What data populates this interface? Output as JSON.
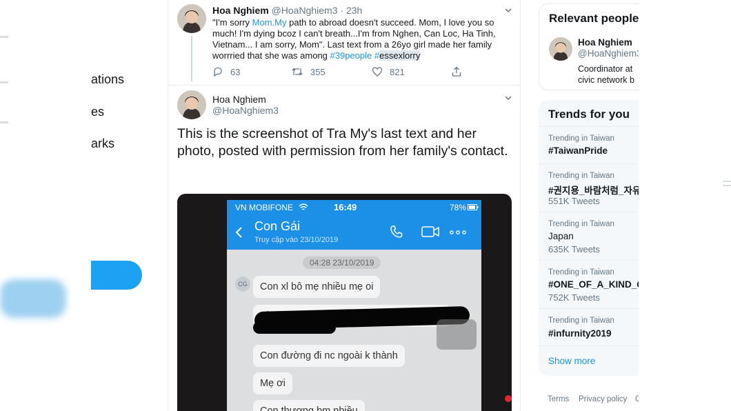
{
  "nav": {
    "items": [
      "ations",
      "es",
      "arks"
    ]
  },
  "tweet1": {
    "name": "Hoa Nghiem",
    "handle": "@HoaNghiem3",
    "time": "· 23h",
    "text_1": "\"I'm sorry ",
    "link_mom": "Mom.My",
    "text_2": " path to abroad doesn't succeed. Mom, I love you so much! I'm dying bcoz I can't breath...I'm from Nghen, Can Loc, Ha Tinh, Vietnam... I am sorry, Mom\". Last text from a 26yo girl made her family worrried that she was among ",
    "hashtag_1": "#39people",
    "hashtag_2_hash": "#",
    "hashtag_2_word": "essexlorry",
    "replies": "63",
    "retweets": "355",
    "likes": "821"
  },
  "tweet2": {
    "name": "Hoa Nghiem",
    "handle": "@HoaNghiem3",
    "text": "This is the screenshot of Tra My's last text and her photo, posted with permission from her family's contact."
  },
  "phone": {
    "carrier": "VN MOBIFONE",
    "time": "16:49",
    "battery": "78%",
    "chat_name": "Con Gái",
    "chat_subtitle": "Truy cập vào 23/10/2019",
    "date_chip": "04:28 23/10/2019",
    "avatar_initials": "CG",
    "messages": [
      "Con xl bô mẹ nhiều mẹ oi",
      "Ph",
      "Con đường đi nc ngoài k thành",
      "Mẹ ơi",
      "Con thương bm nhiều"
    ]
  },
  "sidebar": {
    "relevant_title": "Relevant people",
    "relevant_name": "Hoa Nghiem",
    "relevant_handle": "@HoaNghiem3",
    "relevant_bio": "Coordinator at civic network b",
    "trends_title": "Trends for you",
    "trends": [
      {
        "context": "Trending in Taiwan",
        "name": "#TaiwanPride",
        "count": ""
      },
      {
        "context": "Trending in Taiwan",
        "name": "#권지용_바람처럼_자유",
        "count": "551K Tweets"
      },
      {
        "context": "Trending in Taiwan",
        "name": "Japan",
        "count": "635K Tweets"
      },
      {
        "context": "Trending in Taiwan",
        "name": "#ONE_OF_A_KIND_G",
        "count": "752K Tweets"
      },
      {
        "context": "Trending in Taiwan",
        "name": "#infurnity2019",
        "count": ""
      }
    ],
    "show_more": "Show more",
    "footer_terms": "Terms",
    "footer_privacy": "Privacy policy",
    "footer_more": "C"
  },
  "colors": {
    "accent": "#1da1f2",
    "link": "#1b95e0",
    "phone_header": "#1c8fe6"
  }
}
